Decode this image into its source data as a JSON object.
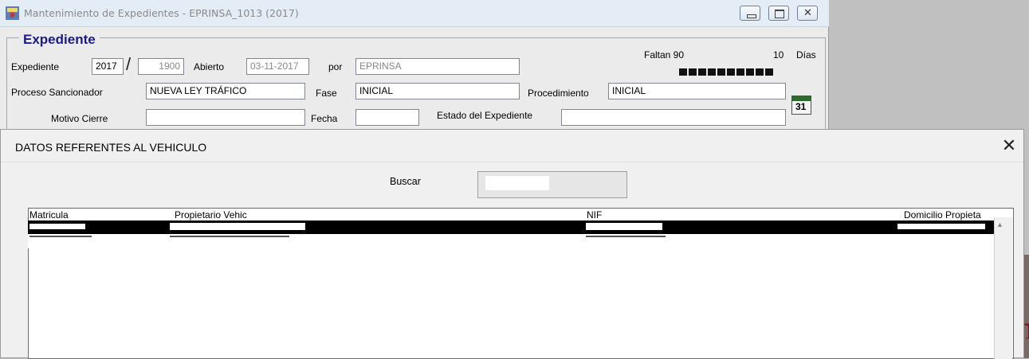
{
  "window": {
    "title": "Mantenimiento de Expedientes - EPRINSA_1013 (2017)",
    "buttons": [
      "minimize",
      "maximize",
      "close"
    ]
  },
  "expediente": {
    "group_title": "Expediente",
    "expediente_label": "Expediente",
    "year": "2017",
    "number": "1900",
    "abierto_label": "Abierto",
    "abierto_date": "03-11-2017",
    "por_label": "por",
    "por_value": "EPRINSA",
    "faltan_label": "Faltan 90",
    "dias_count": "10",
    "dias_label": "Días",
    "proceso_label": "Proceso Sancionador",
    "proceso_value": "NUEVA LEY TRÁFICO",
    "fase_label": "Fase",
    "fase_value": "INICIAL",
    "procedimiento_label": "Procedimiento",
    "procedimiento_value": "INICIAL",
    "motivo_label": "Motivo Cierre",
    "motivo_value": "",
    "fecha_label": "Fecha",
    "fecha_value": "",
    "estado_label": "Estado del Expediente",
    "estado_value": "",
    "calendar_day": "31"
  },
  "dialog": {
    "title": "DATOS REFERENTES AL VEHICULO",
    "close_glyph": "✕",
    "buscar_label": "Buscar",
    "columns": [
      "Matricula",
      "Propietario Vehic",
      "NIF",
      "Domicilio Propieta"
    ],
    "rows_redacted": 2
  },
  "colors": {
    "group_title": "#1a1a8c",
    "title_text": "#8a8a8a",
    "progress": "#111111"
  }
}
